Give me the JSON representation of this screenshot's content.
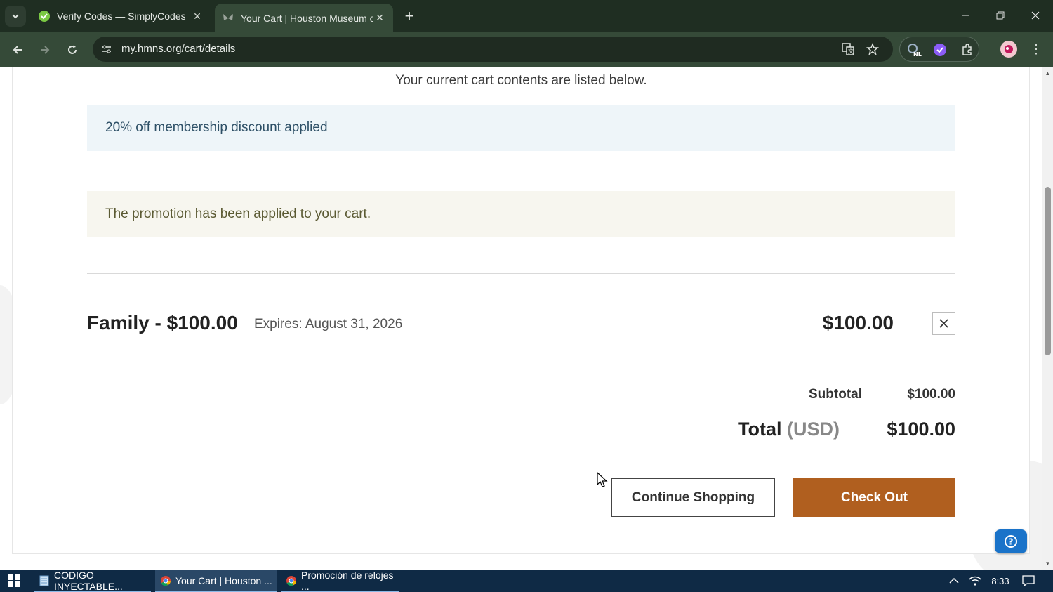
{
  "browser": {
    "tabs": [
      {
        "title": "Verify Codes — SimplyCodes",
        "active": false
      },
      {
        "title": "Your Cart | Houston Museum of",
        "active": true
      }
    ],
    "url": "my.hmns.org/cart/details"
  },
  "page": {
    "intro_text": "Your current cart contents are listed below.",
    "discount_notice": "20% off membership discount applied",
    "promo_notice": "The promotion has been applied to your cart.",
    "cart_items": [
      {
        "name": "Family - $100.00",
        "expires": "Expires: August 31, 2026",
        "price": "$100.00"
      }
    ],
    "subtotal_label": "Subtotal",
    "subtotal_value": "$100.00",
    "total_label": "Total",
    "total_currency": "(USD)",
    "total_value": "$100.00",
    "continue_label": "Continue Shopping",
    "checkout_label": "Check Out"
  },
  "taskbar": {
    "items": [
      {
        "label": "CODIGO INYECTABLE..."
      },
      {
        "label": "Your Cart | Houston ..."
      },
      {
        "label": "Promoción de relojes ..."
      }
    ],
    "time": "8:33"
  },
  "colors": {
    "checkout_button": "#b05f1f",
    "browser_frame": "#354a38",
    "taskbar": "#0f2a45",
    "help_button": "#1a73c9"
  }
}
